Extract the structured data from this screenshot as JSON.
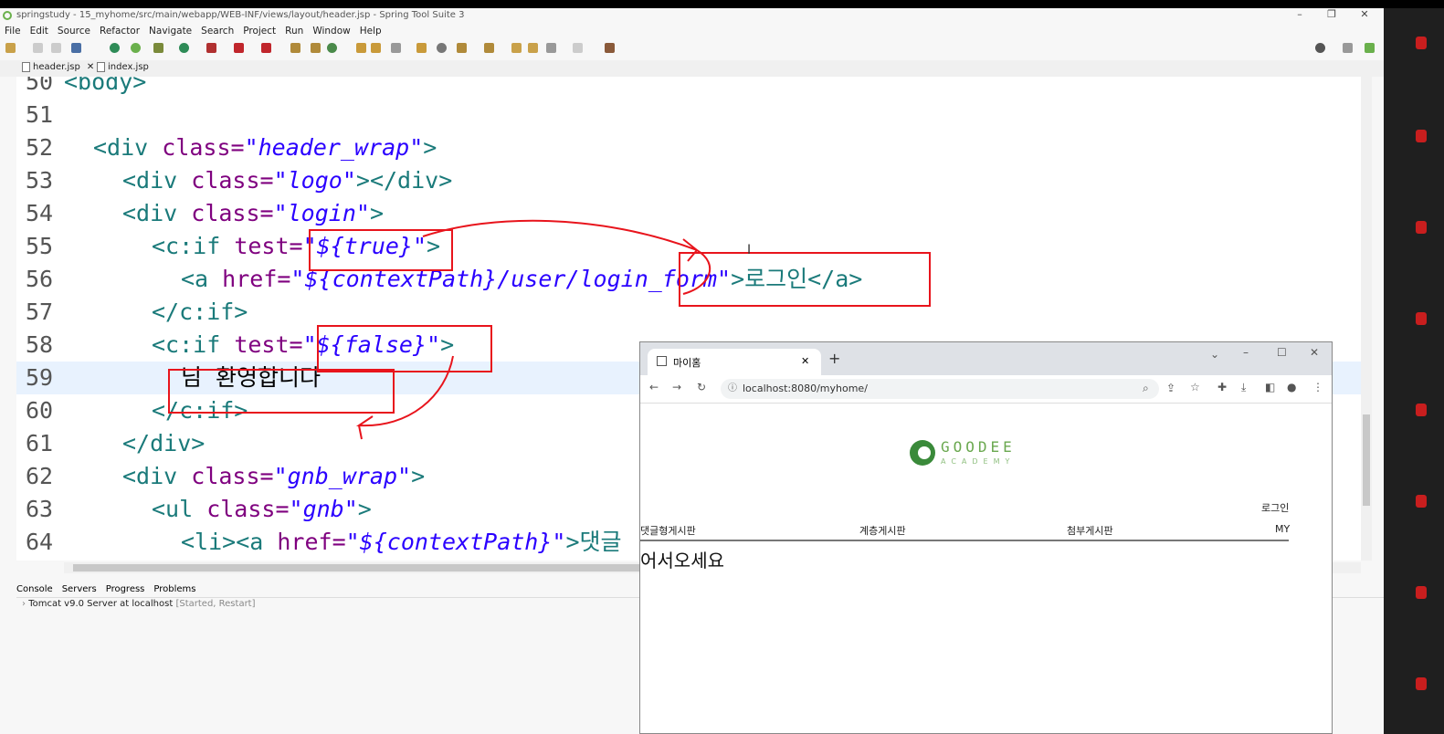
{
  "window": {
    "title": "springstudy - 15_myhome/src/main/webapp/WEB-INF/views/layout/header.jsp - Spring Tool Suite 3",
    "minimize": "–",
    "restore": "❐",
    "close": "✕"
  },
  "menu": [
    "File",
    "Edit",
    "Source",
    "Refactor",
    "Navigate",
    "Search",
    "Project",
    "Run",
    "Window",
    "Help"
  ],
  "editor_tabs": [
    {
      "label": "header.jsp",
      "close": "✕"
    },
    {
      "label": "index.jsp"
    }
  ],
  "code_lines": [
    {
      "num": "50",
      "text": "<body>"
    },
    {
      "num": "51",
      "text": ""
    },
    {
      "num": "52",
      "tag": "<div",
      "attr": " class=",
      "str": "\"header_wrap\"",
      "tail": ">"
    },
    {
      "num": "53",
      "tag": "<div",
      "attr": " class=",
      "str": "\"logo\"",
      "tail": "></div>"
    },
    {
      "num": "54",
      "tag": "<div",
      "attr": " class=",
      "str": "\"login\"",
      "tail": ">"
    },
    {
      "num": "55",
      "tag": "<c:if",
      "attr": " test=",
      "str": "\"${true}\"",
      "tail": ">"
    },
    {
      "num": "56",
      "tag": "<a",
      "attr": " href=",
      "str": "\"${contextPath}/user/login_form\"",
      "tail": ">로그인</a>"
    },
    {
      "num": "57",
      "tag": "</c:if>",
      "attr": "",
      "str": "",
      "tail": ""
    },
    {
      "num": "58",
      "tag": "<c:if",
      "attr": " test=",
      "str": "\"${false}\"",
      "tail": ">"
    },
    {
      "num": "59",
      "text": "님 환영합니다"
    },
    {
      "num": "60",
      "tag": "</c:if>",
      "attr": "",
      "str": "",
      "tail": ""
    },
    {
      "num": "61",
      "tag": "</div>",
      "attr": "",
      "str": "",
      "tail": ""
    },
    {
      "num": "62",
      "tag": "<div",
      "attr": " class=",
      "str": "\"gnb_wrap\"",
      "tail": ">"
    },
    {
      "num": "63",
      "tag": "<ul",
      "attr": " class=",
      "str": "\"gnb\"",
      "tail": ">"
    },
    {
      "num": "64",
      "tag": "<li><a",
      "attr": " href=",
      "str": "\"${contextPath}\"",
      "tail": ">댓글"
    }
  ],
  "bottom_tabs": [
    "Console",
    "Servers",
    "Progress",
    "Problems"
  ],
  "servers": {
    "entry": "Tomcat v9.0 Server at localhost",
    "state": "[Started, Restart]"
  },
  "browser": {
    "tab_title": "마이홈",
    "tab_close": "✕",
    "new_tab": "+",
    "url": "localhost:8080/myhome/",
    "logo_text": "GOODEE",
    "logo_sub": "ACADEMY",
    "login_link": "로그인",
    "nav": [
      "댓글형게시판",
      "계층게시판",
      "첨부게시판",
      "MY"
    ],
    "welcome": "어서오세요"
  },
  "colors": {
    "annotation_red": "#e8141c",
    "tag": "#1a7a7a",
    "attr": "#7f007f",
    "string": "#2a00ff"
  }
}
